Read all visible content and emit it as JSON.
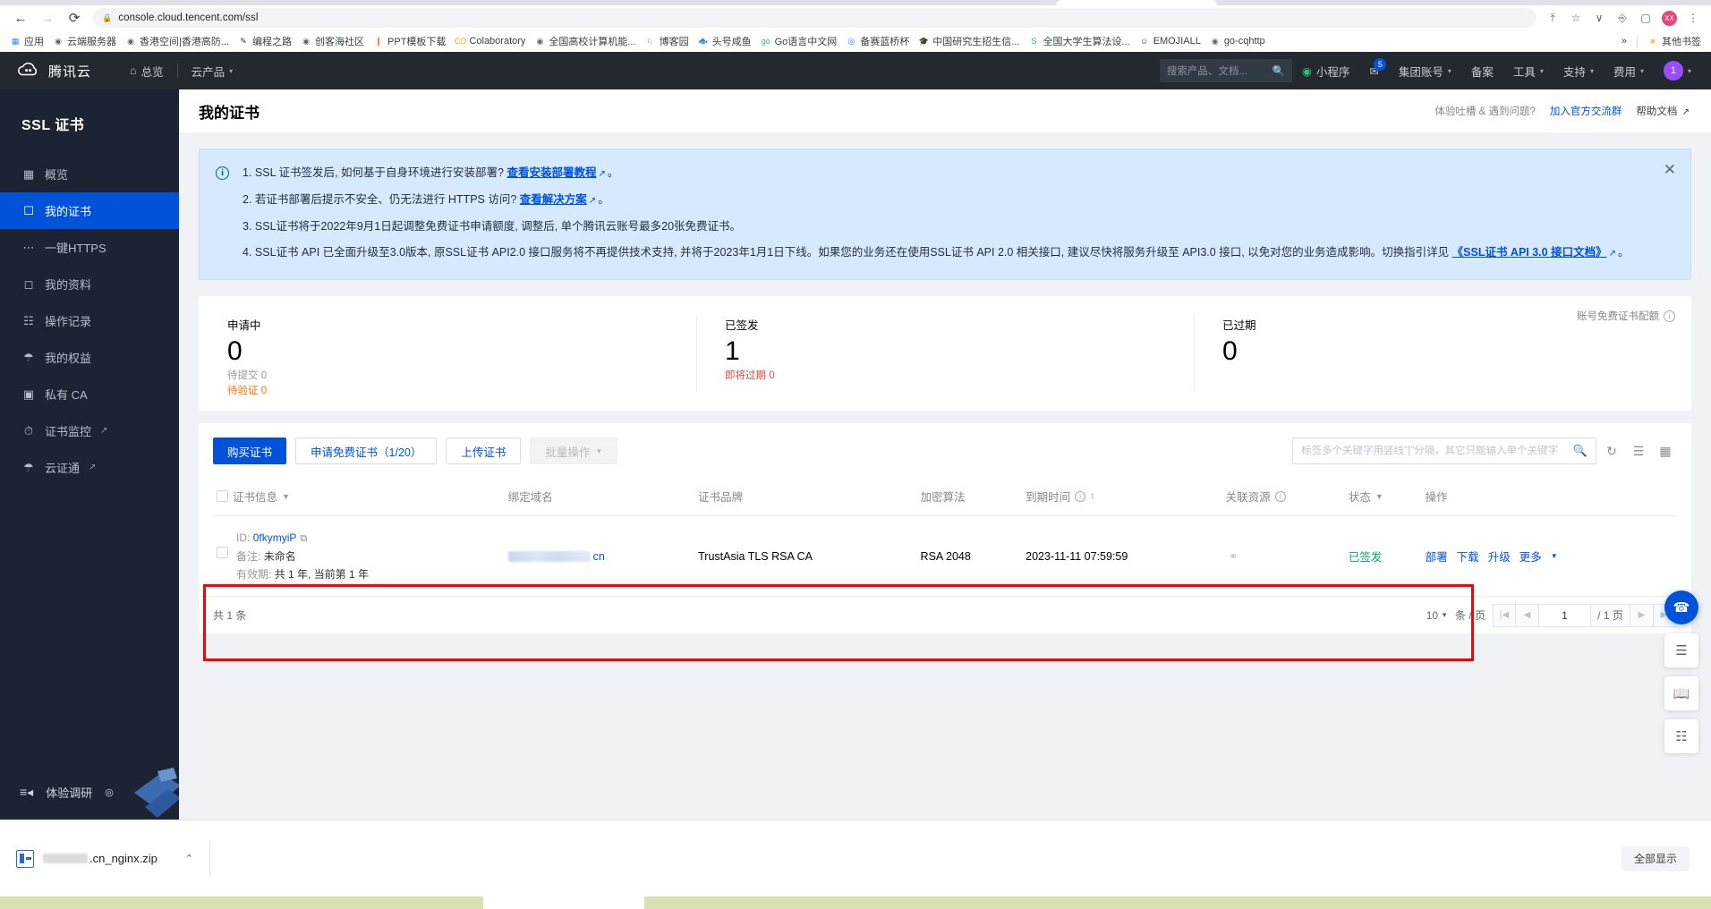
{
  "browser": {
    "url": "console.cloud.tencent.com/ssl",
    "back_icon": "←",
    "forward_icon": "→",
    "reload_icon": "⟳",
    "lock_icon": "🔒",
    "share_icon": "⇪",
    "star_icon": "☆",
    "split_icon": "▥",
    "ext_icon": "🧩",
    "window_icon": "▭",
    "menu_icon": "⋮",
    "profile_initials": "XX",
    "bookmarks": [
      {
        "label": "应用",
        "icon": "▦",
        "color": "#4285f4"
      },
      {
        "label": "云端服务器",
        "icon": "◉",
        "color": "#5f6368"
      },
      {
        "label": "香港空间|香港高防...",
        "icon": "◉",
        "color": "#5f6368"
      },
      {
        "label": "编程之路",
        "icon": "✎",
        "color": "#333333"
      },
      {
        "label": "创客海社区",
        "icon": "◉",
        "color": "#5f6368"
      },
      {
        "label": "PPT模板下载",
        "icon": "❙",
        "color": "#ff5a2e"
      },
      {
        "label": "Colaboratory",
        "icon": "CO",
        "color": "#f9ab00"
      },
      {
        "label": "全国高校计算机能...",
        "icon": "◉",
        "color": "#5f6368"
      },
      {
        "label": "博客园",
        "icon": "♘",
        "color": "#2e6da4"
      },
      {
        "label": "头号咸鱼",
        "icon": "🐟",
        "color": "#4caf50"
      },
      {
        "label": "Go语言中文网",
        "icon": "go",
        "color": "#4cae8a"
      },
      {
        "label": "备赛蓝桥杯",
        "icon": "◎",
        "color": "#3b82f6"
      },
      {
        "label": "中国研究生招生信...",
        "icon": "🎓",
        "color": "#333333"
      },
      {
        "label": "全国大学生算法设...",
        "icon": "S",
        "color": "#19b39c"
      },
      {
        "label": "EMOJIALL",
        "icon": "☺",
        "color": "#333333"
      },
      {
        "label": "go-cqhttp",
        "icon": "◉",
        "color": "#5f6368"
      }
    ],
    "overflow_label": "»",
    "other_bookmarks": {
      "label": "其他书签",
      "icon": "📁"
    }
  },
  "top_nav": {
    "brand": "腾讯云",
    "items": [
      {
        "label": "总览",
        "icon": "home-icon"
      },
      {
        "label": "云产品",
        "icon": "chevron-down-icon"
      }
    ],
    "search_placeholder": "搜索产品、文档...",
    "search_icon": "search-icon",
    "right_items": [
      {
        "label": "小程序",
        "icon": "miniprogram-icon",
        "badge": ""
      },
      {
        "label": "",
        "icon": "mail-icon",
        "badge": "5"
      },
      {
        "label": "集团账号",
        "icon": "chevron-down-icon",
        "badge": ""
      },
      {
        "label": "备案",
        "icon": "",
        "badge": ""
      },
      {
        "label": "工具",
        "icon": "chevron-down-icon",
        "badge": ""
      },
      {
        "label": "支持",
        "icon": "chevron-down-icon",
        "badge": ""
      },
      {
        "label": "费用",
        "icon": "chevron-down-icon",
        "badge": ""
      }
    ],
    "avatar_text": "1"
  },
  "sidebar": {
    "title": "SSL 证书",
    "items": [
      {
        "label": "概览",
        "icon": "grid-icon",
        "active": false,
        "external": false
      },
      {
        "label": "我的证书",
        "icon": "certificate-icon",
        "active": true,
        "external": false
      },
      {
        "label": "一键HTTPS",
        "icon": "sliders-icon",
        "active": false,
        "external": false
      },
      {
        "label": "我的资料",
        "icon": "folder-icon",
        "active": false,
        "external": false
      },
      {
        "label": "操作记录",
        "icon": "list-icon",
        "active": false,
        "external": false
      },
      {
        "label": "我的权益",
        "icon": "gift-icon",
        "active": false,
        "external": false
      },
      {
        "label": "私有 CA",
        "icon": "ca-icon",
        "active": false,
        "external": false
      },
      {
        "label": "证书监控",
        "icon": "monitor-icon",
        "active": false,
        "external": true
      },
      {
        "label": "云证通",
        "icon": "shield-icon",
        "active": false,
        "external": true
      }
    ],
    "footer": {
      "label": "体验调研",
      "icon": "collapse-icon",
      "play_icon": "▶"
    }
  },
  "page": {
    "title": "我的证书",
    "header_right_text": "体验吐槽 & 遇到问题?",
    "header_link": "加入官方交流群",
    "header_link2": "帮助文档"
  },
  "notice": {
    "icon": "info-icon",
    "close_icon": "✕",
    "items": [
      {
        "num": "1.",
        "text": "SSL 证书签发后, 如何基于自身环境进行安装部署?",
        "link": "查看安装部署教程",
        "tail": "。"
      },
      {
        "num": "2.",
        "text": "若证书部署后提示不安全、仍无法进行 HTTPS 访问?",
        "link": "查看解决方案",
        "tail": "。"
      },
      {
        "num": "3.",
        "text": "SSL证书将于2022年9月1日起调整免费证书申请额度, 调整后, 单个腾讯云账号最多20张免费证书。",
        "link": "",
        "tail": ""
      },
      {
        "num": "4.",
        "text": "SSL证书 API 已全面升级至3.0版本, 原SSL证书 API2.0 接口服务将不再提供技术支持, 并将于2023年1月1日下线。如果您的业务还在使用SSL证书 API 2.0 相关接口, 建议尽快将服务升级至 API3.0 接口, 以免对您的业务造成影响。切换指引详见",
        "link": "《SSL证书 API 3.0 接口文档》",
        "tail": "。"
      }
    ]
  },
  "stats": {
    "quota_label": "账号免费证书配额",
    "quota_icon": "info-icon",
    "cards": [
      {
        "label": "申请中",
        "value": "0",
        "subs": [
          {
            "text": "待提交 0",
            "tone": "grey"
          },
          {
            "text": "待验证 0",
            "tone": "orange"
          }
        ]
      },
      {
        "label": "已签发",
        "value": "1",
        "subs": [
          {
            "text": "即将过期 0",
            "tone": "red"
          }
        ]
      },
      {
        "label": "已过期",
        "value": "0",
        "subs": []
      }
    ]
  },
  "toolbar": {
    "buy_label": "购买证书",
    "apply_free_label": "申请免费证书（1/20）",
    "upload_label": "上传证书",
    "batch_label": "批量操作",
    "batch_caret": "▼",
    "search_placeholder": "标签多个关键字用竖线\"|\"分隔，其它只能输入单个关键字",
    "search_icon": "search-icon",
    "refresh_icon": "refresh-icon",
    "list_view_icon": "list-view-icon",
    "grid_view_icon": "grid-view-icon"
  },
  "table": {
    "columns": [
      {
        "label": "证书信息",
        "filter": true,
        "info": false,
        "sort": false
      },
      {
        "label": "绑定域名",
        "filter": false,
        "info": false,
        "sort": false
      },
      {
        "label": "证书品牌",
        "filter": false,
        "info": false,
        "sort": false
      },
      {
        "label": "加密算法",
        "filter": false,
        "info": false,
        "sort": false
      },
      {
        "label": "到期时间",
        "filter": false,
        "info": true,
        "sort": true
      },
      {
        "label": "关联资源",
        "filter": false,
        "info": true,
        "sort": false
      },
      {
        "label": "状态",
        "filter": true,
        "info": false,
        "sort": false
      },
      {
        "label": "操作",
        "filter": false,
        "info": false,
        "sort": false
      }
    ],
    "filter_icon": "▼",
    "sort_icon": "⇕",
    "rows": [
      {
        "id_label": "ID:",
        "id_value": "0fkymyiP",
        "copy_icon": "copy-icon",
        "remark_label": "备注:",
        "remark_value": "未命名",
        "validity_label": "有效期:",
        "validity_value": "共 1 年, 当前第 1 年",
        "domain_suffix": "cn",
        "brand": "TrustAsia TLS RSA CA",
        "algorithm": "RSA 2048",
        "expiry": "2023-11-11 07:59:59",
        "resource_icon": "shield-icon",
        "status": "已签发",
        "ops": [
          "部署",
          "下载",
          "升级",
          "更多"
        ],
        "ops_caret": "▼"
      }
    ]
  },
  "pager": {
    "total_text": "共 1 条",
    "page_size": "10",
    "page_size_caret": "▼",
    "per_page_unit": "条 / 页",
    "current_page": "1",
    "total_pages": "/ 1 页",
    "first_icon": "|◀",
    "prev_icon": "◀",
    "next_icon": "▶",
    "last_icon": "▶|"
  },
  "rail": [
    {
      "icon": "headset-icon",
      "name": "support-button",
      "primary": true
    },
    {
      "icon": "document-icon",
      "name": "docs-button",
      "primary": false
    },
    {
      "icon": "book-icon",
      "name": "guide-button",
      "primary": false
    },
    {
      "icon": "feedback-icon",
      "name": "feedback-button",
      "primary": false
    }
  ],
  "downloads": {
    "file_suffix": ".cn_nginx.zip",
    "caret_icon": "⌃",
    "show_all_label": "全部显示"
  }
}
